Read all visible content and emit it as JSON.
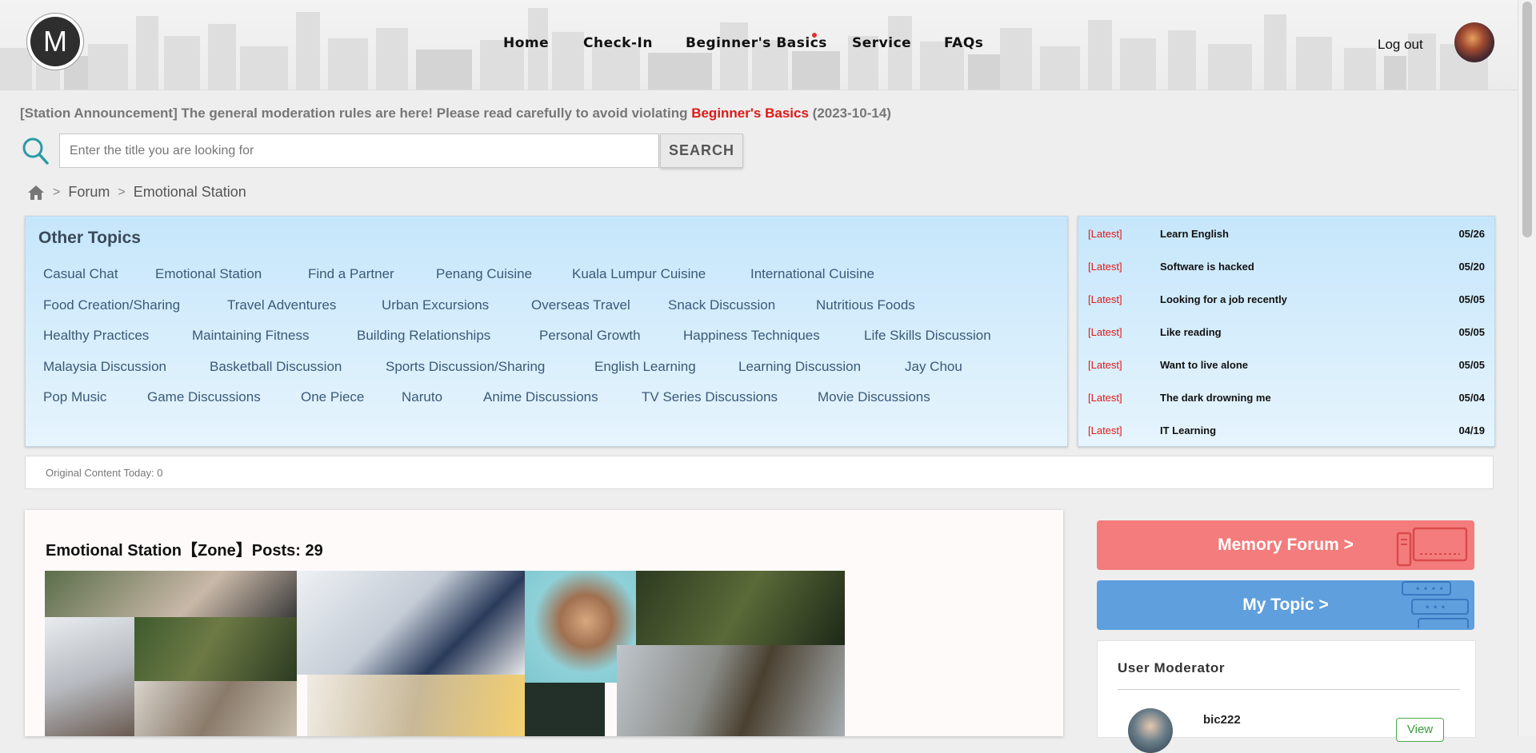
{
  "header": {
    "logo_letter": "M",
    "nav": [
      {
        "label": "Home"
      },
      {
        "label": "Check-In"
      },
      {
        "label": "Beginner's Basics"
      },
      {
        "label": "Service"
      },
      {
        "label": "FAQs"
      }
    ],
    "logout_label": "Log out"
  },
  "announcement": {
    "prefix": "[Station Announcement] The general moderation rules are here! Please read carefully to avoid violating",
    "highlight": "Beginner's Basics",
    "date": "(2023-10-14)"
  },
  "search": {
    "placeholder": "Enter the title you are looking for",
    "button_label": "SEARCH"
  },
  "breadcrumb": {
    "sep": ">",
    "items": [
      "Forum",
      "Emotional Station"
    ]
  },
  "other_topics": {
    "title": "Other Topics",
    "items": [
      "Casual Chat",
      "Emotional Station",
      "Find a Partner",
      "Penang Cuisine",
      "Kuala Lumpur Cuisine",
      "International Cuisine",
      "Food Creation/Sharing",
      "Travel Adventures",
      "Urban Excursions",
      "Overseas Travel",
      "Snack Discussion",
      "Nutritious Foods",
      "Healthy Practices",
      "Maintaining Fitness",
      "Building Relationships",
      "Personal Growth",
      "Happiness Techniques",
      "Life Skills Discussion",
      "Malaysia Discussion",
      "Basketball Discussion",
      "Sports Discussion/Sharing",
      "English Learning",
      "Learning Discussion",
      "Jay Chou",
      "Pop Music",
      "Game Discussions",
      "One Piece",
      "Naruto",
      "Anime Discussions",
      "TV Series Discussions",
      "Movie Discussions"
    ]
  },
  "latest": [
    {
      "tag": "[Latest]",
      "title": "Learn English",
      "date": "05/26"
    },
    {
      "tag": "[Latest]",
      "title": "Software is hacked",
      "date": "05/20"
    },
    {
      "tag": "[Latest]",
      "title": "Looking for a job recently",
      "date": "05/05"
    },
    {
      "tag": "[Latest]",
      "title": "Like reading",
      "date": "05/05"
    },
    {
      "tag": "[Latest]",
      "title": "Want to live alone",
      "date": "05/05"
    },
    {
      "tag": "[Latest]",
      "title": "The dark drowning me",
      "date": "05/04"
    },
    {
      "tag": "[Latest]",
      "title": "IT Learning",
      "date": "04/19"
    }
  ],
  "today": "Original Content Today: 0",
  "zone": {
    "title": "Emotional Station【Zone】Posts: 29"
  },
  "sidebar": {
    "memory_forum_label": "Memory Forum >",
    "my_topic_label": "My Topic >",
    "moderator_title": "User Moderator",
    "moderator_name": "bic222",
    "view_label": "View"
  },
  "colors": {
    "accent_red": "#e01818",
    "memory_btn": "#f47c7c",
    "mytopic_btn": "#5f9fdd",
    "panel_blue": "#c6e6fb",
    "view_green": "#4aa84a"
  },
  "icons": [
    "search-icon",
    "home-icon",
    "monitor-icon",
    "chat-bubbles-icon"
  ]
}
